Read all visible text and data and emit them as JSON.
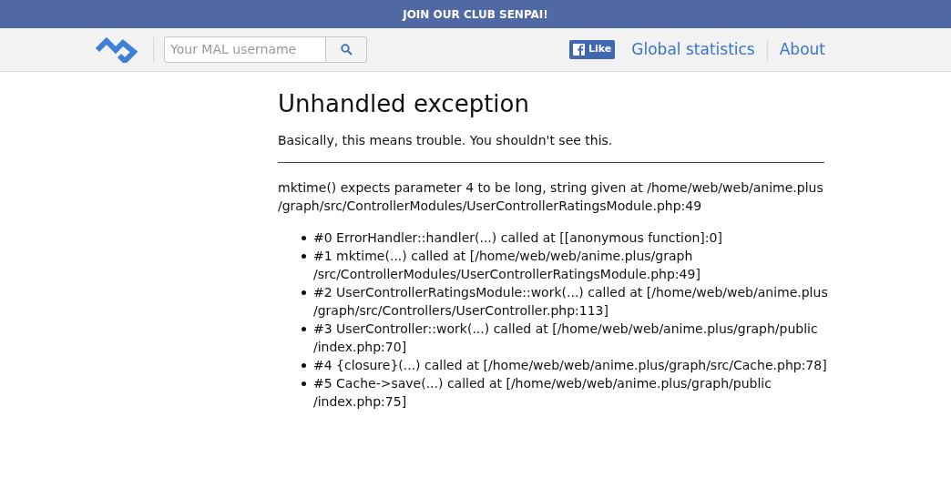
{
  "banner": {
    "text": "JOIN OUR CLUB SENPAI!"
  },
  "header": {
    "search": {
      "placeholder": "Your MAL username"
    },
    "like_button": {
      "label": "Like"
    },
    "nav": [
      {
        "label": "Global statistics"
      },
      {
        "label": "About"
      }
    ]
  },
  "error": {
    "title": "Unhandled exception",
    "subtitle": "Basically, this means trouble. You shouldn't see this.",
    "message_lines": [
      "mktime() expects parameter 4 to be long, string given at /home/web/web/anime.plus",
      "/graph/src/ControllerModules/UserControllerRatingsModule.php:49"
    ],
    "trace": [
      {
        "lines": [
          "#0 ErrorHandler::handler(...) called at [[anonymous function]:0]"
        ]
      },
      {
        "lines": [
          "#1 mktime(...) called at [/home/web/web/anime.plus/graph",
          "/src/ControllerModules/UserControllerRatingsModule.php:49]"
        ]
      },
      {
        "lines": [
          "#2 UserControllerRatingsModule::work(...) called at [/home/web/web/anime.plus",
          "/graph/src/Controllers/UserController.php:113]"
        ]
      },
      {
        "lines": [
          "#3 UserController::work(...) called at [/home/web/web/anime.plus/graph/public",
          "/index.php:70]"
        ]
      },
      {
        "lines": [
          "#4 {closure}(...) called at [/home/web/web/anime.plus/graph/src/Cache.php:78]"
        ]
      },
      {
        "lines": [
          "#5 Cache->save(...) called at [/home/web/web/anime.plus/graph/public",
          "/index.php:75]"
        ]
      }
    ]
  }
}
